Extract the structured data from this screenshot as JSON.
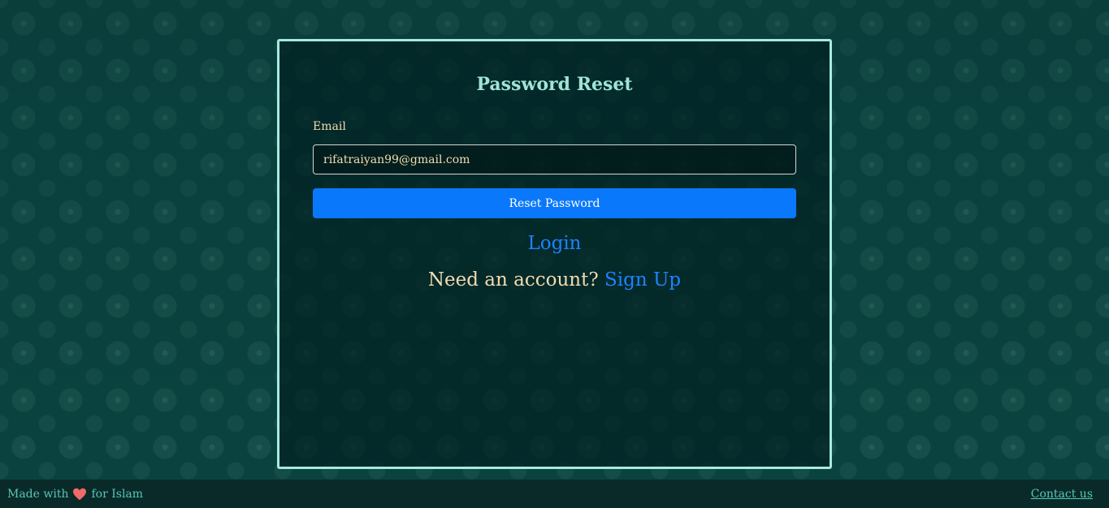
{
  "page": {
    "title": "Password Reset"
  },
  "form": {
    "email_label": "Email",
    "email_value": "rifatraiyan99@gmail.com",
    "reset_button_label": "Reset Password"
  },
  "links": {
    "login": "Login",
    "need_account": "Need an account?",
    "sign_up": "Sign Up"
  },
  "footer": {
    "made_with": "Made with",
    "heart_icon": "heart-icon",
    "for_islam": "for Islam",
    "contact": "Contact us"
  },
  "colors": {
    "accent": "#0a78fb",
    "card_border": "#a6eadf",
    "title": "#9fe4d6",
    "text": "#f1dcb0",
    "link": "#1b84ff",
    "footer_text": "#57c6b6",
    "heart": "#f06a6a"
  }
}
